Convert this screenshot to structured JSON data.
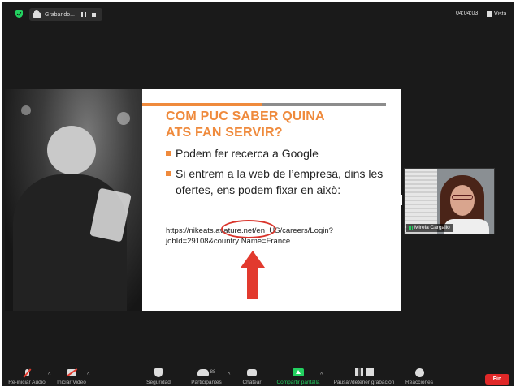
{
  "topbar": {
    "recording_label": "Grabando...",
    "timer": "04:04:03",
    "view_label": "Vista"
  },
  "slide": {
    "title_line1": "COM PUC SABER QUINA",
    "title_line2": "ATS FAN SERVIR?",
    "bullets": [
      "Podem fer recerca a Google",
      "Si entrem a la web de l’empresa, dins les ofertes, ens podem fixar en això:"
    ],
    "url": "https://nikeats.avature.net/en_US/careers/Login?jobId=29108&country Name=France",
    "accent_color": "#ef8a3c",
    "annotation_color": "#e23a2e"
  },
  "speaker": {
    "name": "Mireia Cargallo"
  },
  "toolbar": {
    "audio_label": "Re-iniciar Audio",
    "video_label": "Iniciar Video",
    "security_label": "Seguridad",
    "participants_label": "Participantes",
    "participants_count": "88",
    "chat_label": "Chatear",
    "share_label": "Compartir pantalla",
    "recording_label": "Pausar/detener grabación",
    "reactions_label": "Reacciones",
    "end_label": "Fin"
  }
}
